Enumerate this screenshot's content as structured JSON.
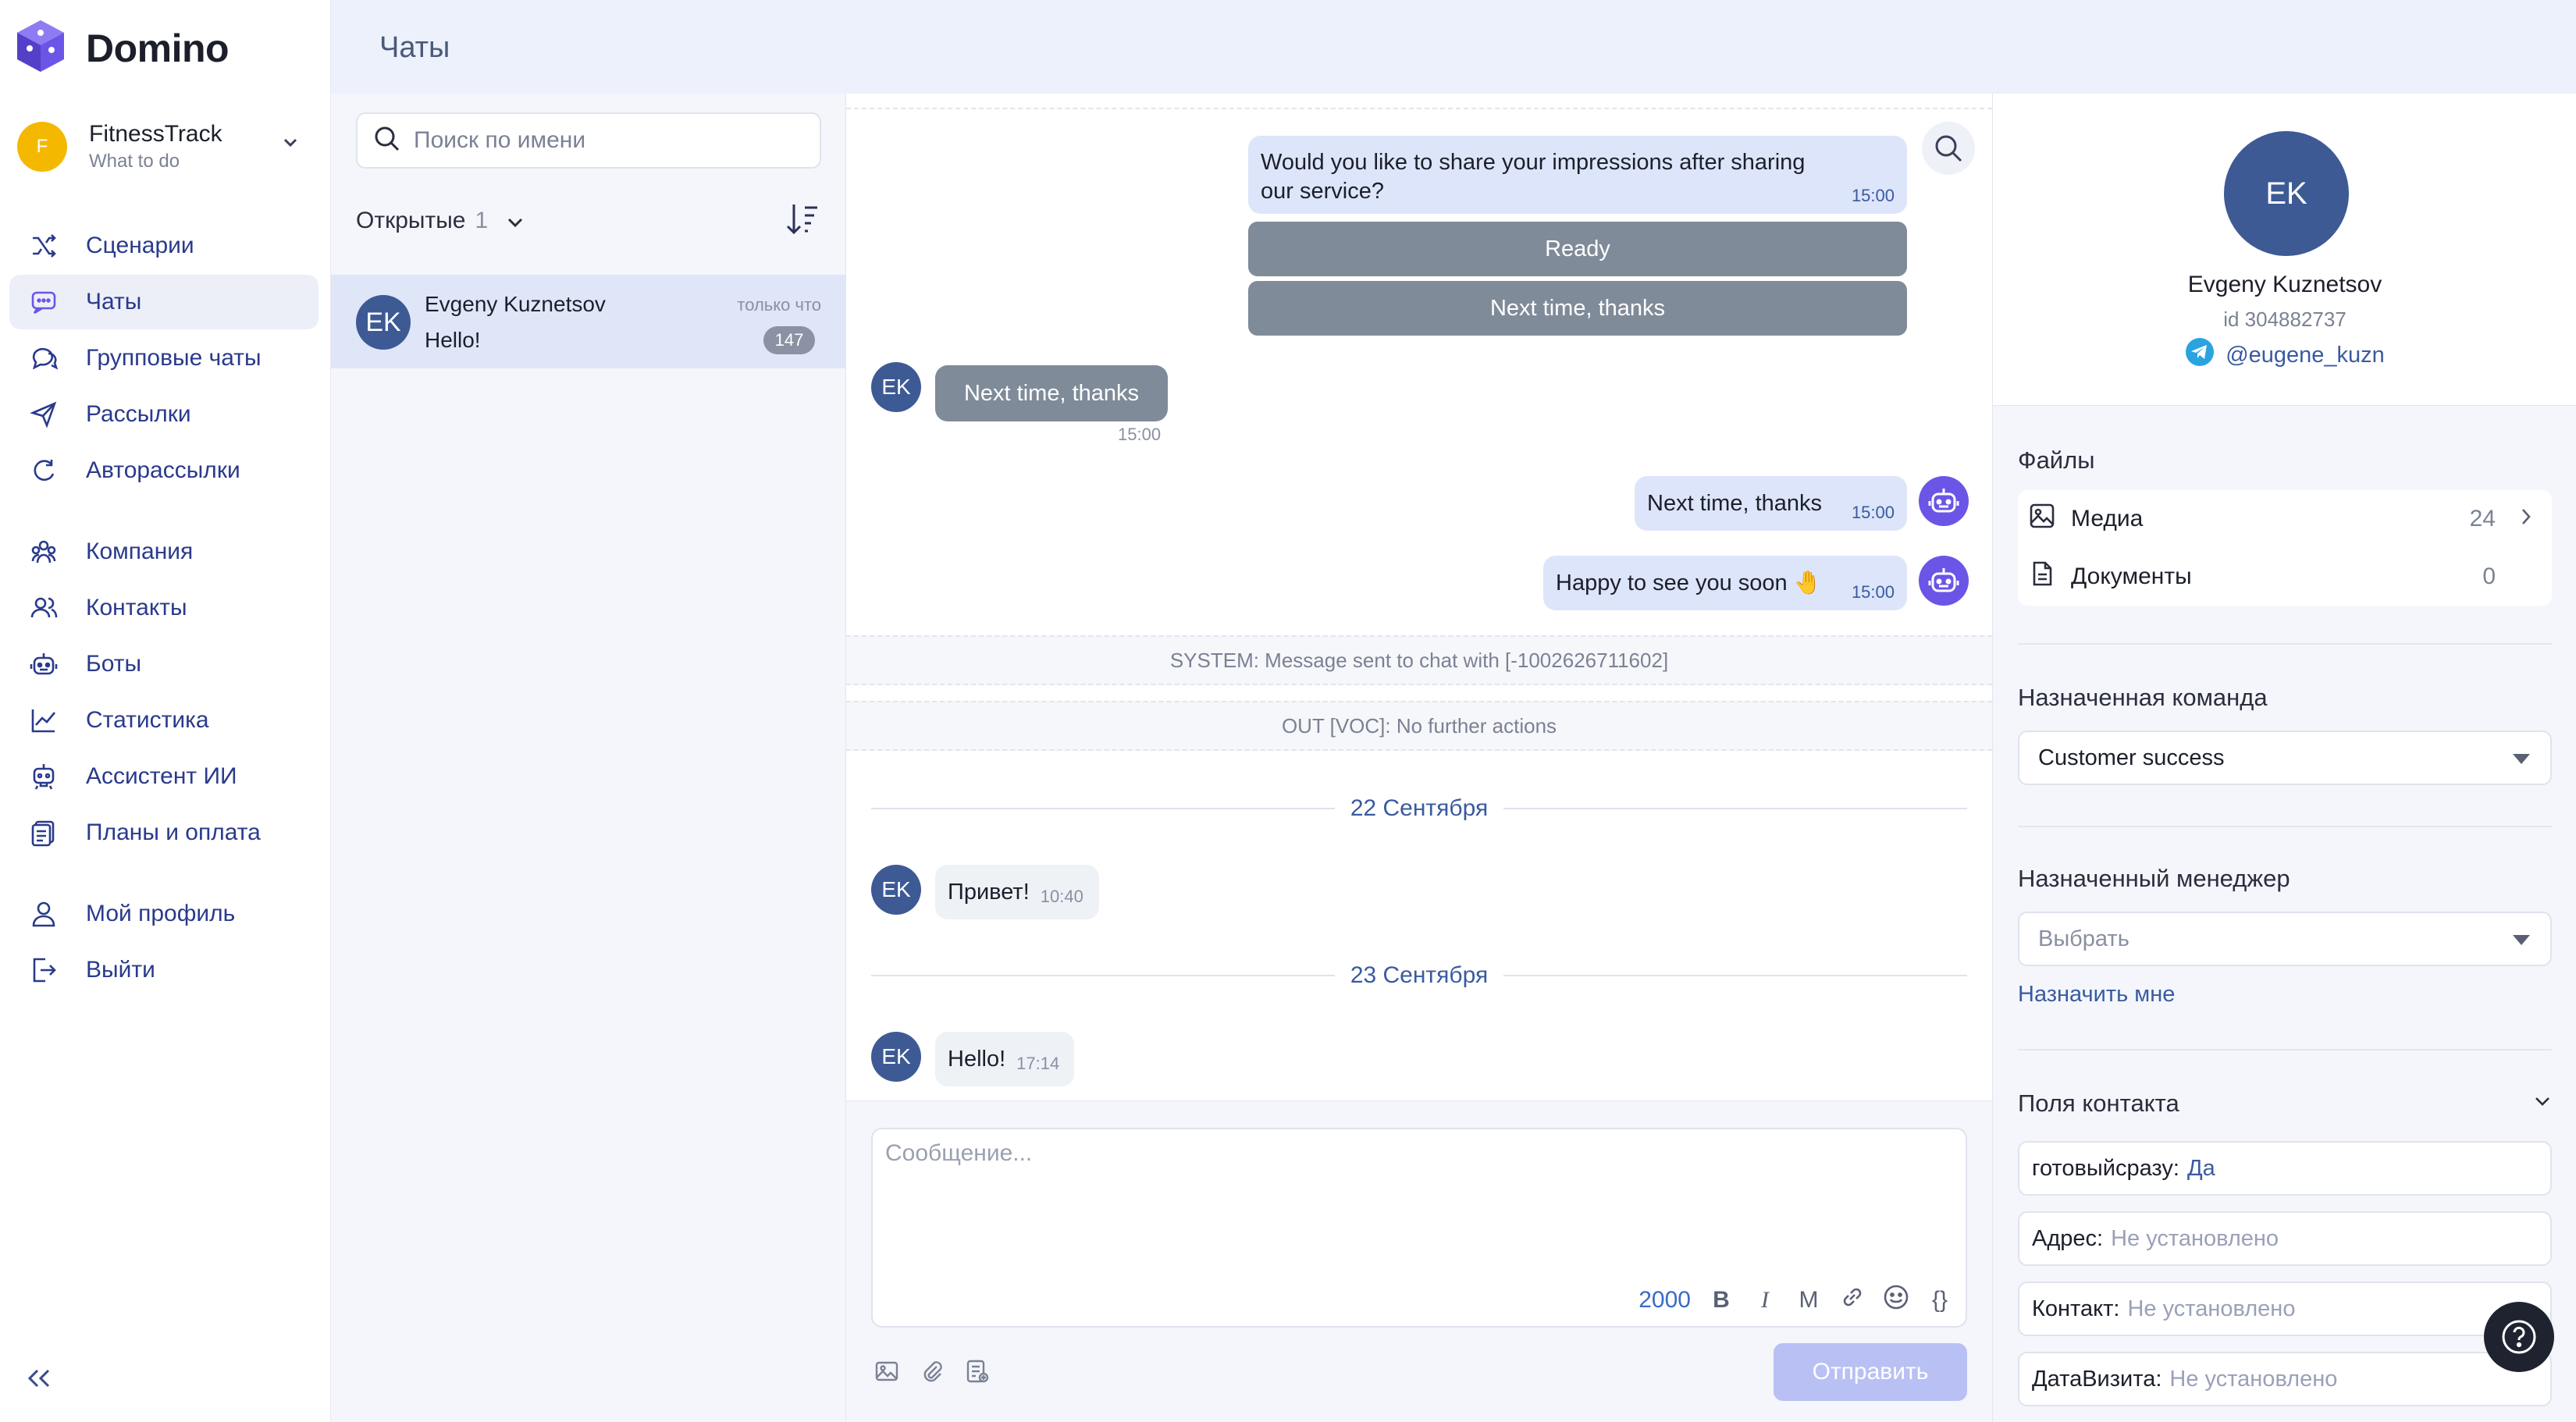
{
  "app": {
    "name": "Domino",
    "page_title": "Чаты"
  },
  "company": {
    "initial": "F",
    "name": "FitnessTrack",
    "subtitle": "What to do"
  },
  "nav": [
    {
      "label": "Сценарии",
      "icon": "shuffle-icon"
    },
    {
      "label": "Чаты",
      "icon": "chat-icon",
      "active": true
    },
    {
      "label": "Групповые чаты",
      "icon": "group-chat-icon"
    },
    {
      "label": "Рассылки",
      "icon": "send-icon"
    },
    {
      "label": "Авторассылки",
      "icon": "auto-send-icon"
    },
    {
      "label": "Компания",
      "icon": "company-icon"
    },
    {
      "label": "Контакты",
      "icon": "contacts-icon"
    },
    {
      "label": "Боты",
      "icon": "bot-icon"
    },
    {
      "label": "Статистика",
      "icon": "stats-icon"
    },
    {
      "label": "Ассистент ИИ",
      "icon": "ai-assistant-icon"
    },
    {
      "label": "Планы и оплата",
      "icon": "billing-icon"
    },
    {
      "label": "Мой профиль",
      "icon": "profile-icon"
    },
    {
      "label": "Выйти",
      "icon": "logout-icon"
    }
  ],
  "chatlist": {
    "search_placeholder": "Поиск по имени",
    "filter_label": "Открытые",
    "filter_count": "1",
    "items": [
      {
        "initials": "EK",
        "name": "Evgeny Kuznetsov",
        "last_message": "Hello!",
        "time": "только что",
        "unread": "147"
      }
    ]
  },
  "messages": {
    "m1": {
      "text": "Would you like to share your impressions after sharing our service?",
      "time": "15:00"
    },
    "kb1": "Ready",
    "kb2": "Next time, thanks",
    "m2": {
      "initials": "EK",
      "text": "Next time, thanks",
      "time": "15:00"
    },
    "m3": {
      "text": "Next time, thanks",
      "time": "15:00"
    },
    "m4": {
      "text": "Happy to see you soon 🤚",
      "time": "15:00"
    },
    "system1": "SYSTEM: Message sent to chat with [-1002626711602]",
    "system2": "OUT [VOC]: No further actions",
    "date1": "22 Сентября",
    "m5": {
      "initials": "EK",
      "text": "Привет!",
      "time": "10:40"
    },
    "date2": "23 Сентября",
    "m6": {
      "initials": "EK",
      "text": "Hello!",
      "time": "17:14"
    }
  },
  "composer": {
    "placeholder": "Сообщение...",
    "char_count": "2000",
    "tools": {
      "bold": "B",
      "italic": "I",
      "mono": "M",
      "braces": "{}"
    },
    "send_label": "Отправить"
  },
  "contact": {
    "initials": "EK",
    "name": "Evgeny Kuznetsov",
    "id": "id 304882737",
    "telegram": "@eugene_kuzn",
    "files_title": "Файлы",
    "media_label": "Медиа",
    "media_count": "24",
    "docs_label": "Документы",
    "docs_count": "0",
    "team_title": "Назначенная команда",
    "team_value": "Customer success",
    "manager_title": "Назначенный менеджер",
    "manager_placeholder": "Выбрать",
    "assign_me": "Назначить мне",
    "fields_title": "Поля контакта",
    "fields": [
      {
        "label": "готовыйсразу:",
        "value": "Да",
        "empty": false
      },
      {
        "label": "Адрес:",
        "value": "Не установлено",
        "empty": true
      },
      {
        "label": "Контакт:",
        "value": "Не установлено",
        "empty": true
      },
      {
        "label": "ДатаВизита:",
        "value": "Не установлено",
        "empty": true
      }
    ]
  },
  "colors": {
    "accent": "#6b55e6",
    "avatar": "#3d5a94",
    "active_nav": "#eceff8"
  }
}
